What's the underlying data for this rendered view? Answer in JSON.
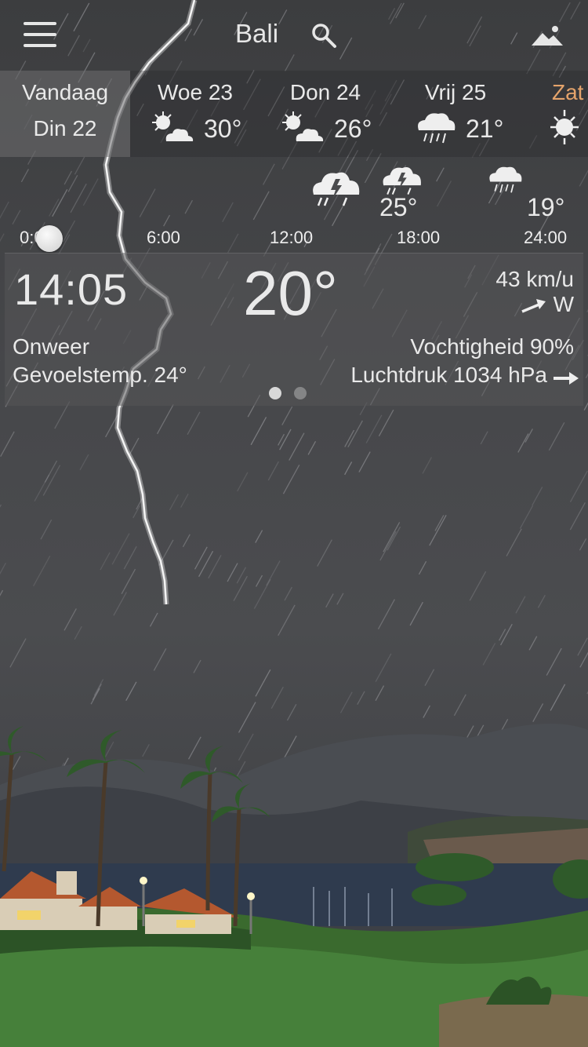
{
  "header": {
    "city": "Bali"
  },
  "days": [
    {
      "name": "Vandaag",
      "date": "Din 22",
      "temp": ""
    },
    {
      "name": "Woe 23",
      "temp": "30°",
      "icon": "sun-cloud-icon"
    },
    {
      "name": "Don 24",
      "temp": "26°",
      "icon": "sun-cloud-icon"
    },
    {
      "name": "Vrij 25",
      "temp": "21°",
      "icon": "rain-cloud-icon"
    },
    {
      "name": "Zat",
      "temp": "",
      "icon": "sun-icon",
      "color": "#e4a36b"
    }
  ],
  "hourly": {
    "temps": [
      "25°",
      "19°"
    ],
    "icons": [
      "thunderstorm-icon",
      "thunderstorm-icon",
      "rain-cloud-icon"
    ],
    "ticks": [
      "0:00",
      "6:00",
      "12:00",
      "18:00",
      "24:00"
    ]
  },
  "current": {
    "time": "14:05",
    "temp": "20°",
    "wind_speed": "43 km/u",
    "wind_dir": "W",
    "condition": "Onweer",
    "feels_like": "Gevoelstemp. 24°",
    "humidity": "Vochtigheid 90%",
    "pressure": "Luchtdruk 1034 hPa"
  },
  "page_dots": {
    "count": 2,
    "active": 0
  },
  "colors": {
    "text": "#e9e9e9",
    "accent_day": "#e4a36b"
  }
}
